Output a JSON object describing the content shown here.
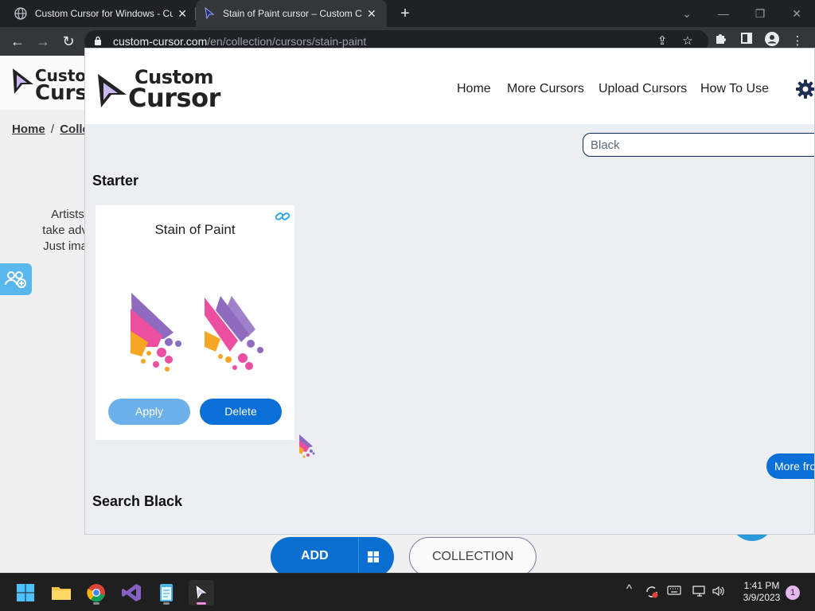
{
  "browser": {
    "tabs": [
      {
        "title": "Custom Cursor for Windows - Cu",
        "active": false
      },
      {
        "title": "Stain of Paint cursor – Custom Cu",
        "active": true
      }
    ],
    "url_host": "custom-cursor.com",
    "url_path": "/en/collection/cursors/stain-paint"
  },
  "background_page": {
    "logo_line1": "Custo",
    "logo_line2": "Curs",
    "breadcrumb_home": "Home",
    "breadcrumb_sep": "/",
    "breadcrumb_current": "Collec",
    "paragraph": [
      "Artists,",
      "take adv",
      "Just ima"
    ],
    "add_label": "ADD",
    "collection_label": "COLLECTION"
  },
  "popup": {
    "logo_line1": "Custom",
    "logo_line2": "Cursor",
    "nav": [
      "Home",
      "More Cursors",
      "Upload Cursors",
      "How To Use"
    ],
    "search_value": "Black",
    "starter_title": "Starter",
    "card": {
      "title": "Stain of Paint",
      "apply_label": "Apply",
      "delete_label": "Delete"
    },
    "more_label": "More fro",
    "search_section_title": "Search Black"
  },
  "taskbar": {
    "time": "1:41 PM",
    "date": "3/9/2023",
    "notification_count": "1"
  },
  "colors": {
    "accent_blue": "#0a6fd6",
    "apply_blue": "#6cb1ea",
    "paint_purple": "#8e6bbf",
    "paint_pink": "#ec4fa0",
    "paint_orange": "#f6a623"
  }
}
